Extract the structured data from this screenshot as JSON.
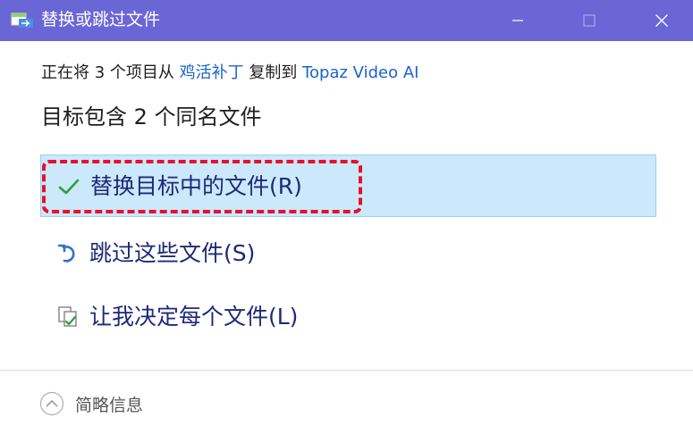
{
  "window": {
    "title": "替换或跳过文件",
    "accent_color": "#6b66d6"
  },
  "copy_info": {
    "prefix": "正在将 3 个项目从",
    "source": "鸡活补丁",
    "middle": "复制到",
    "destination": "Topaz Video AI"
  },
  "conflict": {
    "title": "目标包含 2 个同名文件"
  },
  "options": [
    {
      "label": "替换目标中的文件(R)",
      "icon": "checkmark-icon"
    },
    {
      "label": "跳过这些文件(S)",
      "icon": "undo-arrow-icon"
    },
    {
      "label": "让我决定每个文件(L)",
      "icon": "file-compare-icon"
    }
  ],
  "footer": {
    "details_label": "简略信息"
  },
  "colors": {
    "link": "#1a64c8",
    "selection_bg": "#cce8fb",
    "highlight": "#e8102a"
  }
}
